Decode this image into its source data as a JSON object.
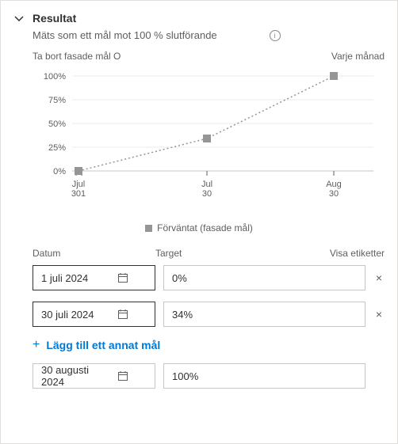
{
  "header": {
    "title": "Resultat",
    "subtitle": "Mäts som ett mål mot 100 % slutförande"
  },
  "chart_row": {
    "left": "Ta bort fasade mål O",
    "right": "Varje månad"
  },
  "chart_data": {
    "type": "line",
    "title": "",
    "xlabel": "",
    "ylabel": "",
    "ylim": [
      0,
      100
    ],
    "y_ticks": [
      "0%",
      "25%",
      "50%",
      "75%",
      "100%"
    ],
    "x_ticks": [
      {
        "label": "Jjul",
        "sublabel": "301"
      },
      {
        "label": "Jul",
        "sublabel": "30"
      },
      {
        "label": "Aug",
        "sublabel": "30"
      }
    ],
    "series": [
      {
        "name": "Förväntat (fasade mål)",
        "values": [
          0,
          34,
          100
        ]
      }
    ]
  },
  "legend": {
    "label": "Förväntat (fasade mål)"
  },
  "form": {
    "headers": {
      "date": "Datum",
      "target": "Target",
      "labels": "Visa etiketter"
    },
    "rows": [
      {
        "date": "1 juli 2024",
        "target": "0%"
      },
      {
        "date": "30 juli 2024",
        "target": "34%"
      }
    ],
    "add_label": "Lägg till ett annat mål",
    "final": {
      "date": "30 augusti 2024",
      "target": "100%"
    }
  }
}
